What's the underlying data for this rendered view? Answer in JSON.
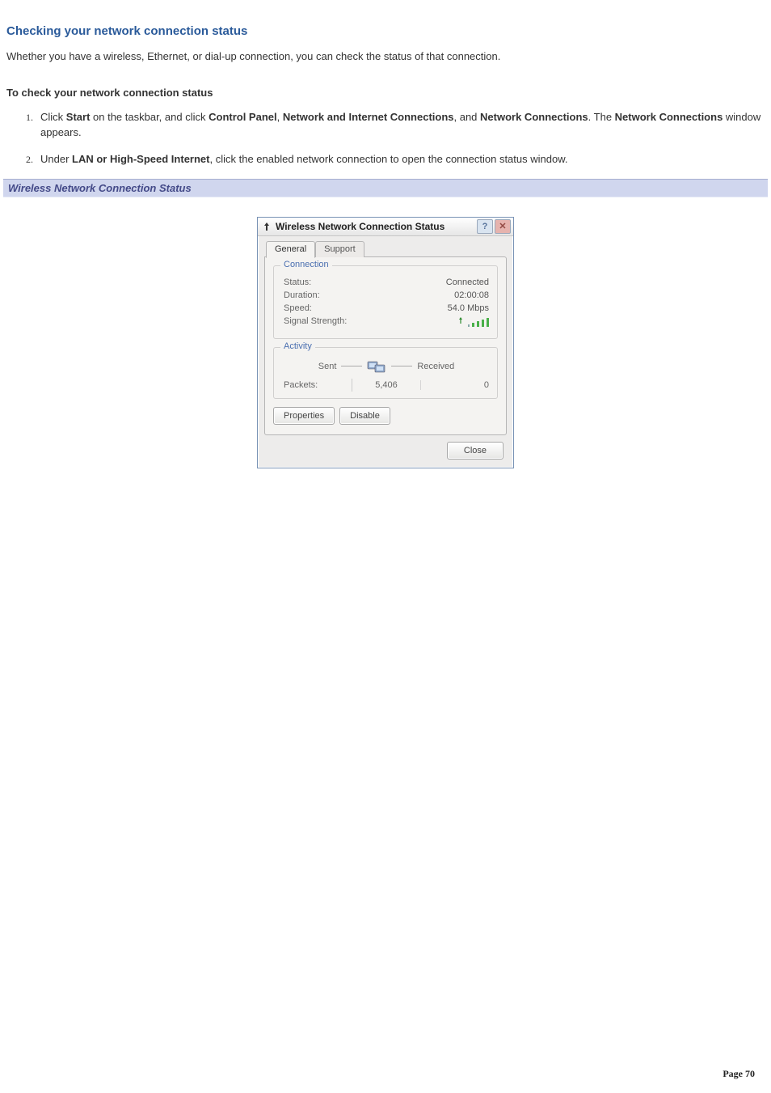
{
  "doc": {
    "heading": "Checking your network connection status",
    "intro_para": "Whether you have a wireless, Ethernet, or dial-up connection, you can check the status of that connection.",
    "subheading": "To check your network connection status",
    "steps": {
      "s1_a": "Click ",
      "s1_b_bold": "Start",
      "s1_c": " on the taskbar, and click ",
      "s1_d_bold": "Control Panel",
      "s1_e": ", ",
      "s1_f_bold": "Network and Internet Connections",
      "s1_g": ", and ",
      "s1_h_bold": "Network Connections",
      "s1_i": ". The ",
      "s1_j_bold": "Network Connections",
      "s1_k": " window appears.",
      "s2_a": "Under ",
      "s2_b_bold": "LAN or High-Speed Internet",
      "s2_c": ", click the enabled network connection to open the connection status window."
    },
    "figure_title": "Wireless Network Connection Status",
    "page_number": "Page 70"
  },
  "dialog": {
    "title": "Wireless Network Connection Status",
    "tabs": {
      "general": "General",
      "support": "Support"
    },
    "group_connection": "Connection",
    "group_activity": "Activity",
    "conn": {
      "status_label": "Status:",
      "status_value": "Connected",
      "duration_label": "Duration:",
      "duration_value": "02:00:08",
      "speed_label": "Speed:",
      "speed_value": "54.0 Mbps",
      "signal_label": "Signal Strength:"
    },
    "activity": {
      "sent_label": "Sent",
      "received_label": "Received",
      "packets_label": "Packets:",
      "packets_sent": "5,406",
      "packets_received": "0"
    },
    "buttons": {
      "properties": "Properties",
      "disable": "Disable",
      "close": "Close",
      "help_glyph": "?",
      "close_glyph": "✕"
    }
  }
}
